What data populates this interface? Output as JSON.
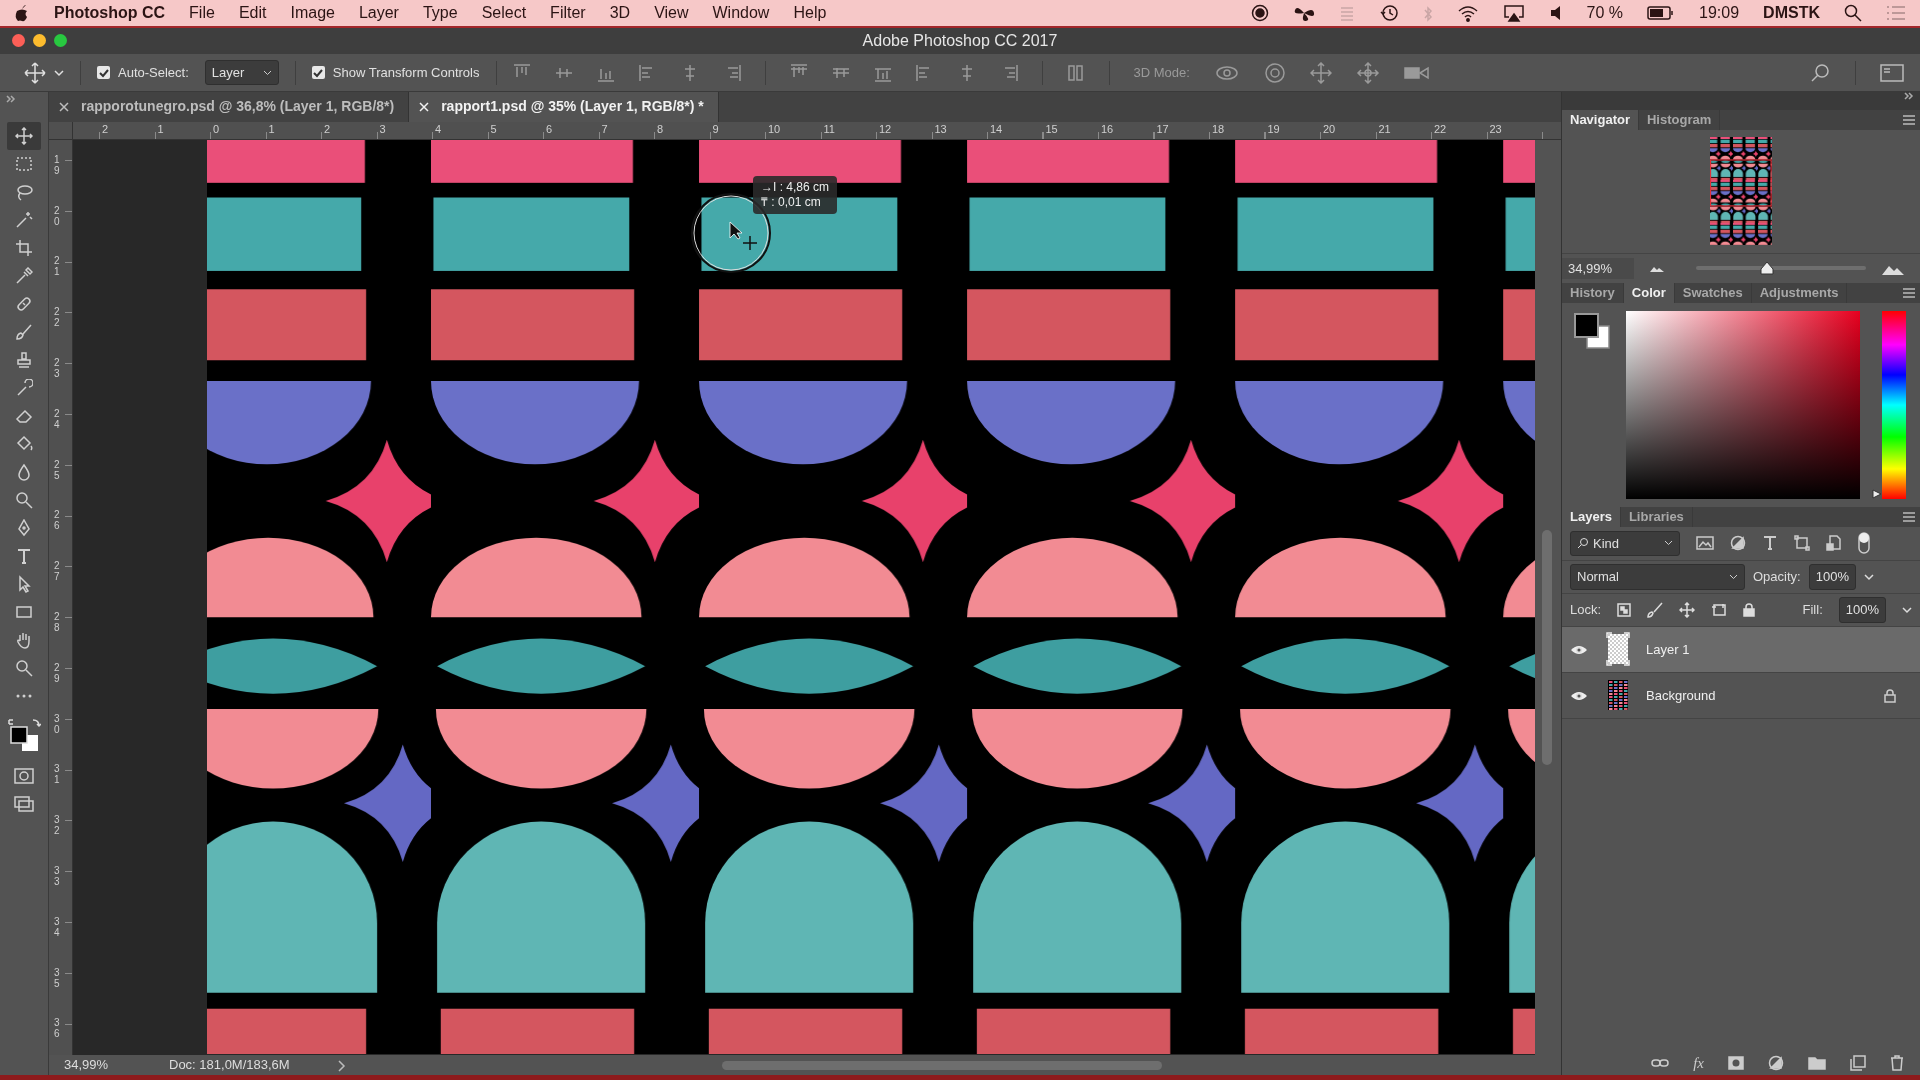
{
  "menubar": {
    "app": "Photoshop CC",
    "menus": [
      "File",
      "Edit",
      "Image",
      "Layer",
      "Type",
      "Select",
      "Filter",
      "3D",
      "View",
      "Window",
      "Help"
    ],
    "battery_text": "70 %",
    "time": "19:09",
    "user": "DMSTK"
  },
  "window": {
    "title": "Adobe Photoshop CC 2017"
  },
  "options_bar": {
    "auto_select": {
      "label": "Auto-Select:",
      "checked": true
    },
    "target": {
      "value": "Layer"
    },
    "transform_controls": {
      "label": "Show Transform Controls",
      "checked": true
    },
    "mode_3d_label": "3D Mode:"
  },
  "document_tabs": [
    {
      "title": "rapporotunegro.psd @ 36,8% (Layer 1, RGB/8*)",
      "selected": false
    },
    {
      "title": "rapport1.psd @ 35% (Layer 1, RGB/8*) *",
      "selected": true
    }
  ],
  "toolbar": {
    "tools": [
      {
        "selected": true
      },
      {
        "selected": false
      },
      {
        "selected": false
      },
      {
        "selected": false
      },
      {
        "selected": false
      },
      {
        "selected": false
      },
      {
        "selected": false
      },
      {
        "selected": false
      },
      {
        "selected": false
      },
      {
        "selected": false
      },
      {
        "selected": false
      },
      {
        "selected": false
      },
      {
        "selected": false
      },
      {
        "selected": false
      },
      {
        "selected": false
      },
      {
        "selected": false
      },
      {
        "selected": false
      },
      {
        "selected": false
      },
      {
        "selected": false
      },
      {
        "selected": false
      },
      {
        "selected": false
      }
    ]
  },
  "rulers": {
    "horizontal": [
      "2",
      "1",
      "0",
      "1",
      "2",
      "3",
      "4",
      "5",
      "6",
      "7",
      "8",
      "9",
      "10",
      "11",
      "12",
      "13",
      "14",
      "15",
      "16",
      "17",
      "18",
      "19",
      "20",
      "21",
      "22",
      "23"
    ],
    "vertical": [
      "19",
      "20",
      "21",
      "22",
      "23",
      "24",
      "25",
      "26",
      "27",
      "28",
      "29",
      "30",
      "31",
      "32",
      "33",
      "34",
      "35",
      "36"
    ]
  },
  "measure_tooltip": [
    "→I : 4,86 cm",
    "₸ : 0,01 cm"
  ],
  "navigator": {
    "tabs": [
      {
        "label": "Navigator",
        "selected": true
      },
      {
        "label": "Histogram",
        "selected": false
      }
    ],
    "zoom": "34,99%",
    "level": 0.42
  },
  "color_panel": {
    "tabs": [
      {
        "label": "History",
        "selected": false
      },
      {
        "label": "Color",
        "selected": true
      },
      {
        "label": "Swatches",
        "selected": false
      },
      {
        "label": "Adjustments",
        "selected": false
      }
    ],
    "hue": {
      "level": 0
    }
  },
  "layers_panel": {
    "tabs": [
      {
        "label": "Layers",
        "selected": true
      },
      {
        "label": "Libraries",
        "selected": false
      }
    ],
    "filter": "Kind",
    "blend_mode": "Normal",
    "opacity_label": "Opacity:",
    "opacity": "100%",
    "lock_label": "Lock:",
    "fill_label": "Fill:",
    "fill": "100%",
    "layers": [
      {
        "name": "Layer 1",
        "selected": true,
        "visible": true,
        "locked": false,
        "kind": "transparent"
      },
      {
        "name": "Background",
        "selected": false,
        "visible": true,
        "locked": true,
        "kind": "pattern"
      }
    ],
    "fx": "fx"
  },
  "status_bar": {
    "zoom": "34,99%",
    "doc": "Doc: 181,0M/183,6M"
  }
}
